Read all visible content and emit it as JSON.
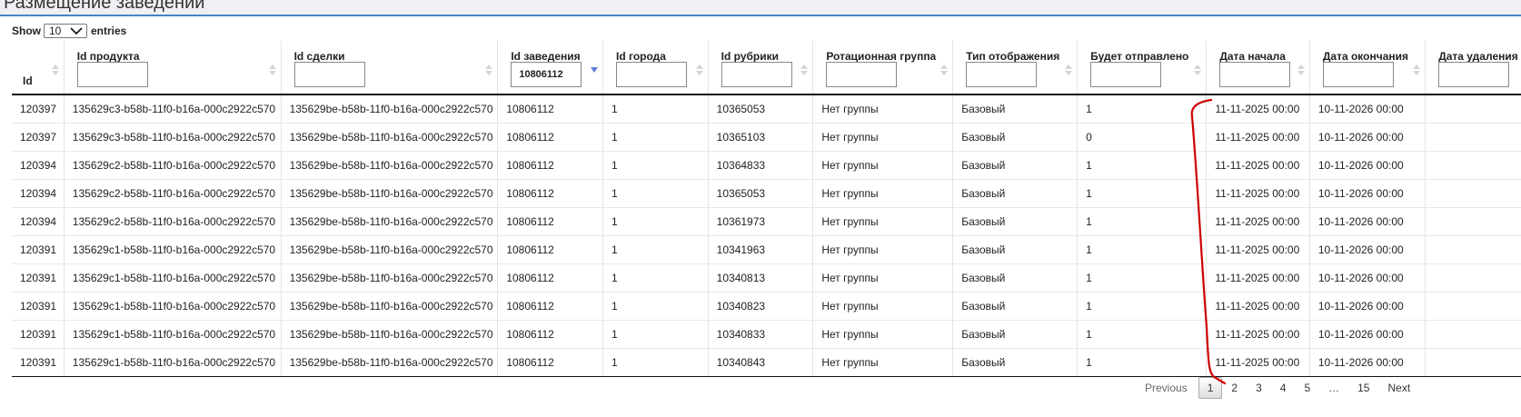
{
  "page": {
    "title": "Размещение заведений"
  },
  "length_menu": {
    "show_label": "Show",
    "value": "10",
    "entries_label": "entries"
  },
  "columns": [
    {
      "label": "Id",
      "filter": null
    },
    {
      "label": "Id продукта",
      "filter": ""
    },
    {
      "label": "Id сделки",
      "filter": ""
    },
    {
      "label": "Id заведения",
      "filter": "10806112"
    },
    {
      "label": "Id города",
      "filter": ""
    },
    {
      "label": "Id рубрики",
      "filter": ""
    },
    {
      "label": "Ротационная группа",
      "filter": ""
    },
    {
      "label": "Тип отображения",
      "filter": ""
    },
    {
      "label": "Будет отправлено",
      "filter": ""
    },
    {
      "label": "Дата начала",
      "filter": ""
    },
    {
      "label": "Дата окончания",
      "filter": ""
    },
    {
      "label": "Дата удаления",
      "filter": ""
    }
  ],
  "rows": [
    [
      "120397",
      "135629c3-b58b-11f0-b16a-000c2922c570",
      "135629be-b58b-11f0-b16a-000c2922c570",
      "10806112",
      "1",
      "10365053",
      "Нет группы",
      "Базовый",
      "1",
      "11-11-2025 00:00",
      "10-11-2026 00:00",
      ""
    ],
    [
      "120397",
      "135629c3-b58b-11f0-b16a-000c2922c570",
      "135629be-b58b-11f0-b16a-000c2922c570",
      "10806112",
      "1",
      "10365103",
      "Нет группы",
      "Базовый",
      "0",
      "11-11-2025 00:00",
      "10-11-2026 00:00",
      ""
    ],
    [
      "120394",
      "135629c2-b58b-11f0-b16a-000c2922c570",
      "135629be-b58b-11f0-b16a-000c2922c570",
      "10806112",
      "1",
      "10364833",
      "Нет группы",
      "Базовый",
      "1",
      "11-11-2025 00:00",
      "10-11-2026 00:00",
      ""
    ],
    [
      "120394",
      "135629c2-b58b-11f0-b16a-000c2922c570",
      "135629be-b58b-11f0-b16a-000c2922c570",
      "10806112",
      "1",
      "10365053",
      "Нет группы",
      "Базовый",
      "1",
      "11-11-2025 00:00",
      "10-11-2026 00:00",
      ""
    ],
    [
      "120394",
      "135629c2-b58b-11f0-b16a-000c2922c570",
      "135629be-b58b-11f0-b16a-000c2922c570",
      "10806112",
      "1",
      "10361973",
      "Нет группы",
      "Базовый",
      "1",
      "11-11-2025 00:00",
      "10-11-2026 00:00",
      ""
    ],
    [
      "120391",
      "135629c1-b58b-11f0-b16a-000c2922c570",
      "135629be-b58b-11f0-b16a-000c2922c570",
      "10806112",
      "1",
      "10341963",
      "Нет группы",
      "Базовый",
      "1",
      "11-11-2025 00:00",
      "10-11-2026 00:00",
      ""
    ],
    [
      "120391",
      "135629c1-b58b-11f0-b16a-000c2922c570",
      "135629be-b58b-11f0-b16a-000c2922c570",
      "10806112",
      "1",
      "10340813",
      "Нет группы",
      "Базовый",
      "1",
      "11-11-2025 00:00",
      "10-11-2026 00:00",
      ""
    ],
    [
      "120391",
      "135629c1-b58b-11f0-b16a-000c2922c570",
      "135629be-b58b-11f0-b16a-000c2922c570",
      "10806112",
      "1",
      "10340823",
      "Нет группы",
      "Базовый",
      "1",
      "11-11-2025 00:00",
      "10-11-2026 00:00",
      ""
    ],
    [
      "120391",
      "135629c1-b58b-11f0-b16a-000c2922c570",
      "135629be-b58b-11f0-b16a-000c2922c570",
      "10806112",
      "1",
      "10340833",
      "Нет группы",
      "Базовый",
      "1",
      "11-11-2025 00:00",
      "10-11-2026 00:00",
      ""
    ],
    [
      "120391",
      "135629c1-b58b-11f0-b16a-000c2922c570",
      "135629be-b58b-11f0-b16a-000c2922c570",
      "10806112",
      "1",
      "10340843",
      "Нет группы",
      "Базовый",
      "1",
      "11-11-2025 00:00",
      "10-11-2026 00:00",
      ""
    ]
  ],
  "pagination": {
    "previous": "Previous",
    "pages": [
      "1",
      "2",
      "3",
      "4",
      "5",
      "…",
      "15"
    ],
    "current": "1",
    "next": "Next"
  },
  "colors": {
    "accent": "#4a84c4",
    "annotation": "#cc0000",
    "sort_active": "#5b7fd6"
  }
}
